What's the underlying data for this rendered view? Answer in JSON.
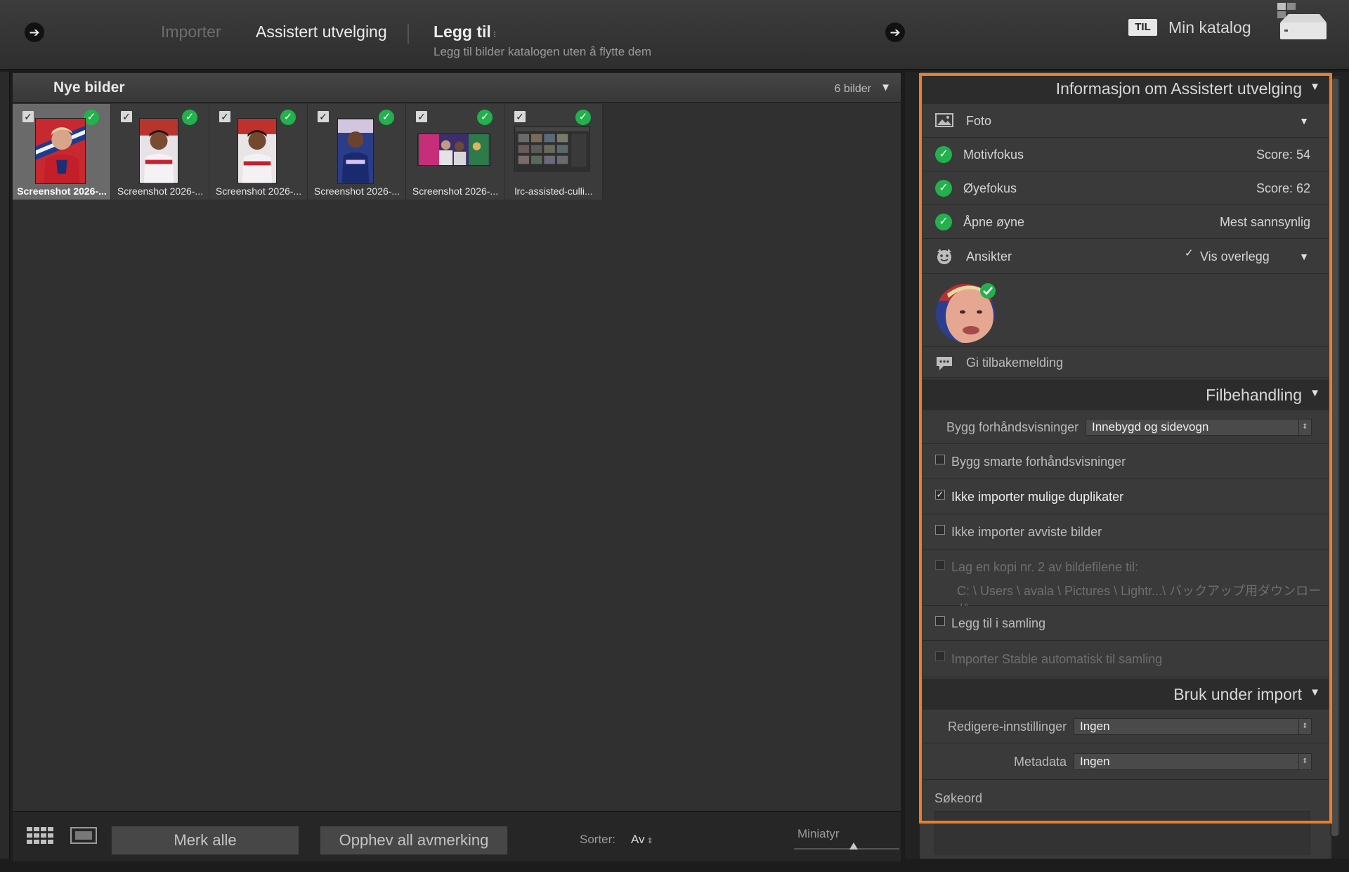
{
  "topbar": {
    "modes": {
      "importer": "Importer",
      "culling": "Assistert utvelging",
      "add": "Legg til",
      "add_subtitle": "Legg til bilder katalogen uten å flytte dem"
    },
    "destination_badge": "TIL",
    "catalog_name": "Min katalog"
  },
  "grid": {
    "title": "Nye bilder",
    "count": "6 bilder",
    "thumbnails": [
      {
        "caption": "Screenshot 2026-...",
        "checked": true,
        "selected": true
      },
      {
        "caption": "Screenshot 2026-...",
        "checked": true,
        "selected": false
      },
      {
        "caption": "Screenshot 2026-...",
        "checked": true,
        "selected": false
      },
      {
        "caption": "Screenshot 2026-...",
        "checked": true,
        "selected": false
      },
      {
        "caption": "Screenshot 2026-...",
        "checked": true,
        "selected": false
      },
      {
        "caption": "lrc-assisted-culli...",
        "checked": true,
        "selected": false
      }
    ]
  },
  "bottombar": {
    "check_all": "Merk alle",
    "uncheck_all": "Opphev all avmerking",
    "sort_label": "Sorter:",
    "sort_value": "Av",
    "thumbnail_label": "Miniatyr"
  },
  "panel": {
    "culling_info": {
      "title": "Informasjon om Assistert utvelging",
      "photo_label": "Foto",
      "subject_focus": {
        "label": "Motivfokus",
        "value": "Score: 54"
      },
      "eye_focus": {
        "label": "Øyefokus",
        "value": "Score: 62"
      },
      "eyes_open": {
        "label": "Åpne øyne",
        "value": "Mest sannsynlig"
      },
      "faces_label": "Ansikter",
      "show_overlay": "Vis overlegg",
      "feedback": "Gi tilbakemelding"
    },
    "file_handling": {
      "title": "Filbehandling",
      "build_previews_label": "Bygg forhåndsvisninger",
      "build_previews_value": "Innebygd og sidevogn",
      "smart_previews": "Bygg smarte forhåndsvisninger",
      "no_duplicates": "Ikke importer mulige duplikater",
      "no_rejected": "Ikke importer avviste bilder",
      "second_copy": "Lag en kopi nr. 2 av bildefilene til:",
      "second_copy_path": "C: \\ Users \\ avala \\ Pictures \\ Lightr...\\ バックアップ用ダウンロード",
      "add_to_collection": "Legg til i samling",
      "stack_auto": "Importer Stable automatisk til samling"
    },
    "apply_during_import": {
      "title": "Bruk under import",
      "develop_label": "Redigere-innstillinger",
      "develop_value": "Ingen",
      "metadata_label": "Metadata",
      "metadata_value": "Ingen",
      "keywords_label": "Søkeord"
    }
  },
  "colors": {
    "highlight": "#f07d25",
    "check_green": "#22b14c"
  }
}
